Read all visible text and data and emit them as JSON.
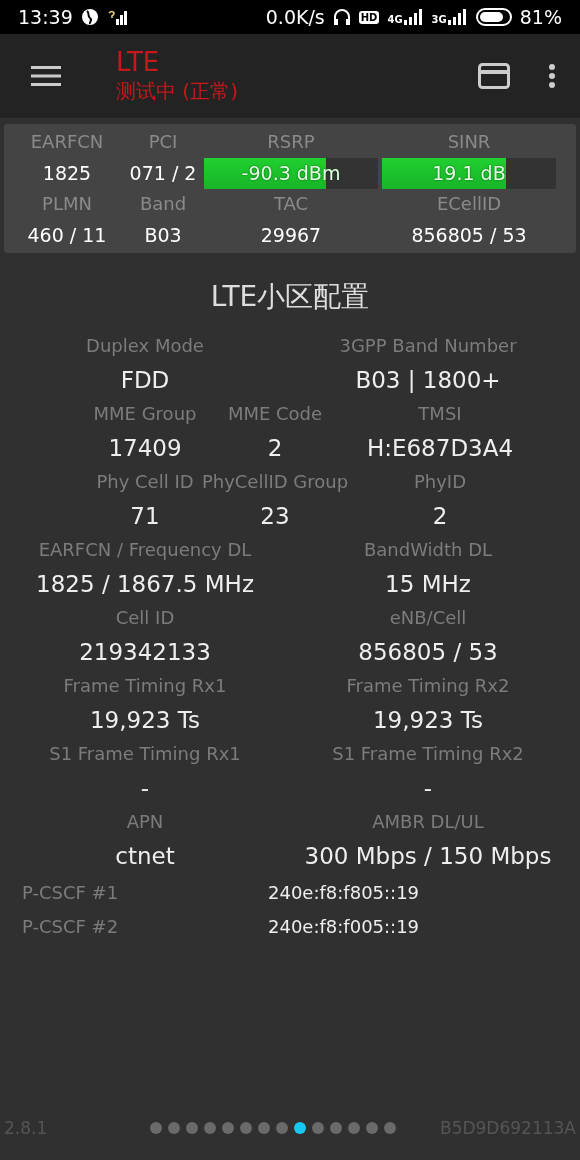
{
  "status_bar": {
    "time": "13:39",
    "speed": "0.0K/s",
    "hd": "HD",
    "net_1": "4G",
    "net_2": "3G",
    "battery": "81%"
  },
  "toolbar": {
    "title": "LTE",
    "subtitle": "测试中 (正常)"
  },
  "summary": {
    "rows": [
      [
        {
          "label": "EARFCN",
          "value": "1825",
          "kind": "text"
        },
        {
          "label": "PCI",
          "value": "071 / 2",
          "kind": "text"
        },
        {
          "label": "RSRP",
          "value": "-90.3 dBm",
          "kind": "meter",
          "level": 0.7
        },
        {
          "label": "SINR",
          "value": "19.1 dB",
          "kind": "meter",
          "level": 0.71
        }
      ],
      [
        {
          "label": "PLMN",
          "value": "460 / 11",
          "kind": "text"
        },
        {
          "label": "Band",
          "value": "B03",
          "kind": "text"
        },
        {
          "label": "TAC",
          "value": "29967",
          "kind": "text"
        },
        {
          "label": "ECellID",
          "value": "856805 / 53",
          "kind": "text"
        }
      ]
    ]
  },
  "section": {
    "title": "LTE小区配置",
    "rows": [
      [
        {
          "label": "Duplex Mode",
          "value": "FDD"
        },
        {
          "label": "3GPP Band Number",
          "value": "B03 | 1800+"
        }
      ],
      [
        {
          "label": "MME Group",
          "value": "17409"
        },
        {
          "label": "MME Code",
          "value": "2"
        },
        {
          "label": "TMSI",
          "value": "H:E687D3A4"
        }
      ],
      [
        {
          "label": "Phy Cell ID",
          "value": "71"
        },
        {
          "label": "PhyCellID Group",
          "value": "23"
        },
        {
          "label": "PhyID",
          "value": "2"
        }
      ],
      [
        {
          "label": "EARFCN / Frequency DL",
          "value": "1825 / 1867.5 MHz"
        },
        {
          "label": "BandWidth DL",
          "value": "15 MHz"
        }
      ],
      [
        {
          "label": "Cell ID",
          "value": "219342133"
        },
        {
          "label": "eNB/Cell",
          "value": "856805 / 53"
        }
      ],
      [
        {
          "label": "Frame Timing Rx1",
          "value": "19,923 Ts"
        },
        {
          "label": "Frame Timing Rx2",
          "value": "19,923 Ts"
        }
      ],
      [
        {
          "label": "S1 Frame Timing Rx1",
          "value": "-"
        },
        {
          "label": "S1 Frame Timing Rx2",
          "value": "-"
        }
      ],
      [
        {
          "label": "APN",
          "value": "ctnet"
        },
        {
          "label": "AMBR DL/UL",
          "value": "300 Mbps / 150 Mbps"
        }
      ]
    ],
    "pairs": [
      {
        "label": "P-CSCF #1",
        "value": "240e:f8:f805::19"
      },
      {
        "label": "P-CSCF #2",
        "value": "240e:f8:f005::19"
      }
    ]
  },
  "footer": {
    "version": "2.8.1",
    "device_id": "B5D9D692113A",
    "pages": [
      {
        "selected": false
      },
      {
        "selected": false
      },
      {
        "selected": false
      },
      {
        "selected": false
      },
      {
        "selected": false
      },
      {
        "selected": false
      },
      {
        "selected": false
      },
      {
        "selected": false
      },
      {
        "selected": true
      },
      {
        "selected": false
      },
      {
        "selected": false
      },
      {
        "selected": false
      },
      {
        "selected": false
      },
      {
        "selected": false
      }
    ]
  }
}
